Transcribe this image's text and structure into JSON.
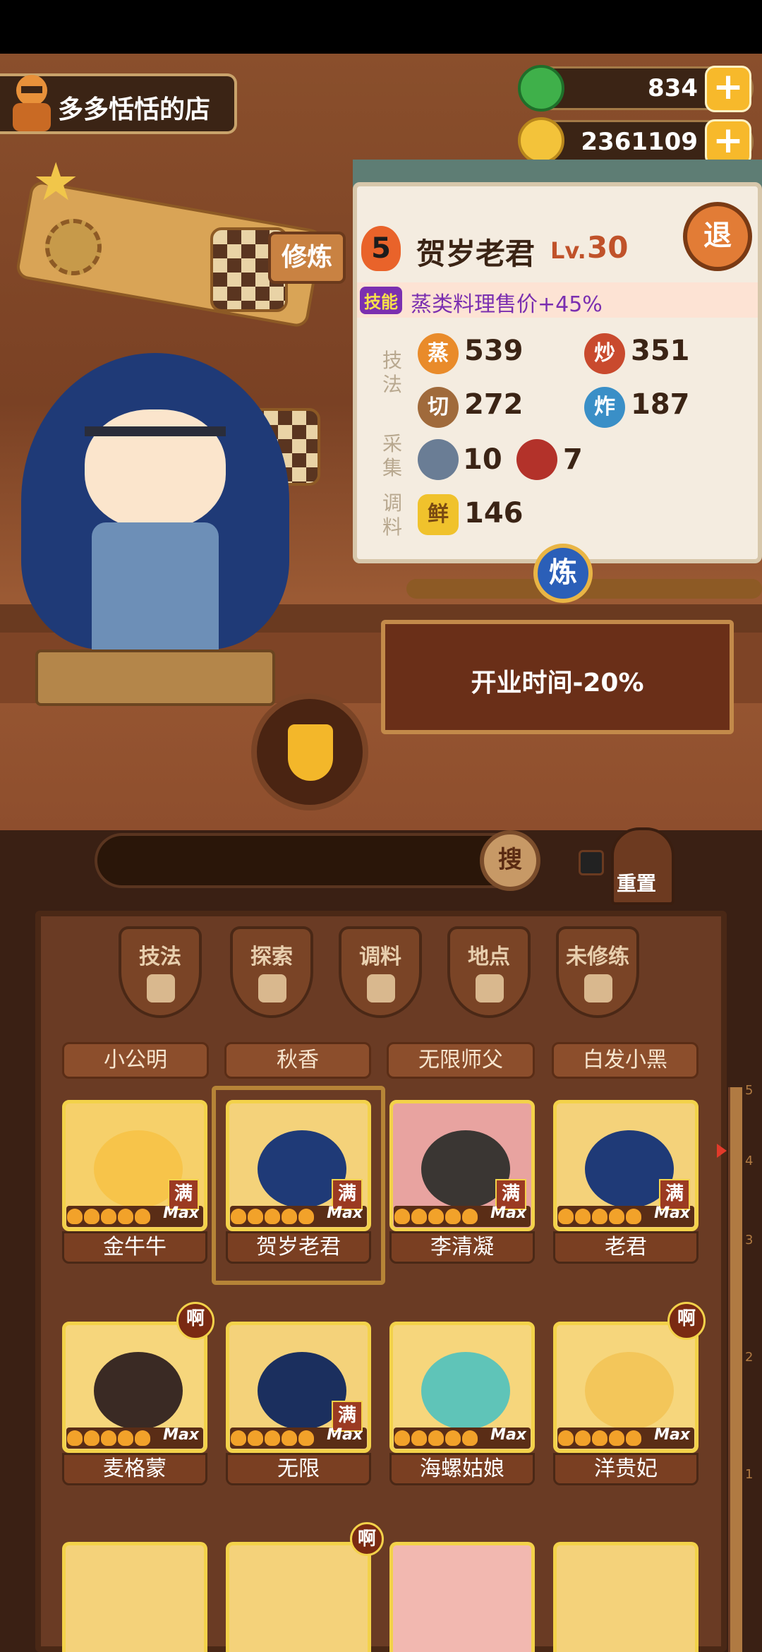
{
  "shop": {
    "name": "多多恬恬的店"
  },
  "currency": {
    "jade": "834",
    "coins": "2361109"
  },
  "training_sign": "修炼",
  "exit_label": "退",
  "chef_detail": {
    "rank": "5",
    "name": "贺岁老君",
    "level_prefix": "Lv.",
    "level": "30",
    "skill_tag": "技能",
    "skill_text": "蒸类料理售价+45%",
    "side_labels": {
      "technique": "技法",
      "gather": "采集",
      "season": "调料"
    },
    "stats": [
      {
        "badge": "蒸",
        "value": "539",
        "color": "#e98b2a"
      },
      {
        "badge": "炒",
        "value": "351",
        "color": "#c94a2e"
      },
      {
        "badge": "切",
        "value": "272",
        "color": "#a06a3b"
      },
      {
        "badge": "炸",
        "value": "187",
        "color": "#3a8fc7"
      }
    ],
    "gather": [
      {
        "icon": "fish-icon",
        "value": "10"
      },
      {
        "icon": "meat-icon",
        "value": "7"
      }
    ],
    "season": {
      "badge": "鲜",
      "value": "146"
    }
  },
  "refine": {
    "label": "炼",
    "effect": "开业时间-20%"
  },
  "search": {
    "button": "搜",
    "reset": "重置"
  },
  "filters": [
    "技法",
    "探索",
    "调料",
    "地点",
    "未修练"
  ],
  "name_chips": [
    "小公明",
    "秋香",
    "无限师父",
    "白发小黑"
  ],
  "chefs": [
    {
      "name": "金牛牛",
      "man": "满",
      "max": "Max",
      "ah": ""
    },
    {
      "name": "贺岁老君",
      "man": "满",
      "max": "Max",
      "ah": ""
    },
    {
      "name": "李清凝",
      "man": "满",
      "max": "Max",
      "ah": ""
    },
    {
      "name": "老君",
      "man": "满",
      "max": "Max",
      "ah": ""
    },
    {
      "name": "麦格蒙",
      "man": "",
      "max": "Max",
      "ah": "啊"
    },
    {
      "name": "无限",
      "man": "满",
      "max": "Max",
      "ah": ""
    },
    {
      "name": "海螺姑娘",
      "man": "",
      "max": "Max",
      "ah": ""
    },
    {
      "name": "洋贵妃",
      "man": "",
      "max": "Max",
      "ah": "啊"
    }
  ],
  "bottom_row_badge": "啊",
  "scroll_marks": [
    "5",
    "4",
    "3",
    "2",
    "1"
  ],
  "colors": {
    "accent": "#f3d24a",
    "wood": "#6a3b24"
  }
}
